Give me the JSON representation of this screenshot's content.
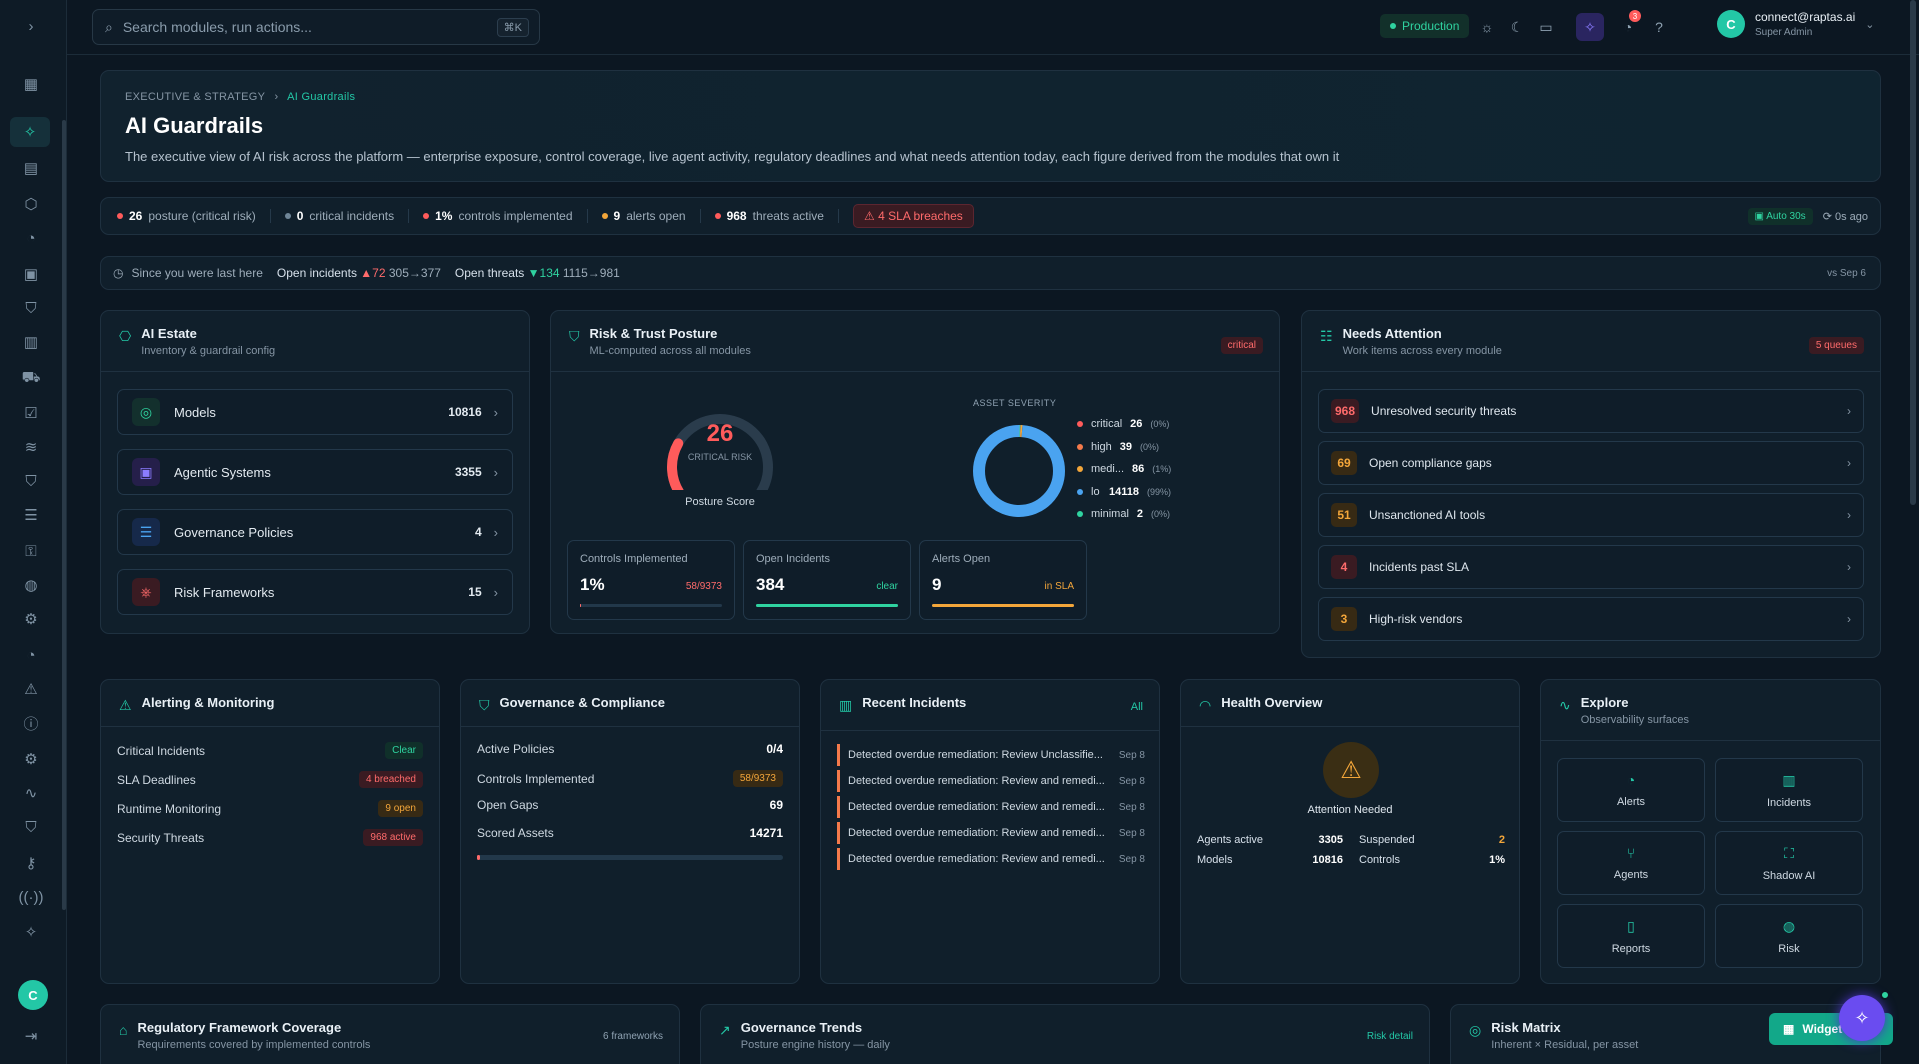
{
  "search": {
    "placeholder": "Search modules, run actions...",
    "shortcut": "⌘K"
  },
  "topbar": {
    "environment": "Production",
    "notification_count": "3",
    "user_email": "connect@raptas.ai",
    "user_role": "Super Admin",
    "avatar_letter": "C"
  },
  "rail": {
    "avatar_letter": "C"
  },
  "hero": {
    "crumb_parent": "EXECUTIVE & STRATEGY",
    "crumb_current": "AI Guardrails",
    "title": "AI Guardrails",
    "description": "The executive view of AI risk across the platform — enterprise exposure, control coverage, live agent activity, regulatory deadlines and what needs attention today, each figure derived from the modules that own it"
  },
  "stats": {
    "items": [
      {
        "value": "26",
        "label": "posture (critical risk)",
        "color": "#ff5b5b"
      },
      {
        "value": "0",
        "label": "critical incidents",
        "color": "#6f8597"
      },
      {
        "value": "1%",
        "label": "controls implemented",
        "color": "#ff5b5b"
      },
      {
        "value": "9",
        "label": "alerts open",
        "color": "#f3a63a"
      },
      {
        "value": "968",
        "label": "threats active",
        "color": "#ff5b5b"
      }
    ],
    "breaches": "4 SLA breaches",
    "auto": "Auto 30s",
    "ago": "0s ago"
  },
  "since": {
    "label": "Since you were last here",
    "incidents_label": "Open incidents",
    "incidents_delta": "▲72",
    "incidents_range": "305→377",
    "threats_label": "Open threats",
    "threats_delta": "▼134",
    "threats_range": "1115→981",
    "vs": "vs Sep 6"
  },
  "estate": {
    "title": "AI Estate",
    "subtitle": "Inventory & guardrail config",
    "items": [
      {
        "label": "Models",
        "value": "10816"
      },
      {
        "label": "Agentic Systems",
        "value": "3355"
      },
      {
        "label": "Governance Policies",
        "value": "4"
      },
      {
        "label": "Risk Frameworks",
        "value": "15"
      }
    ]
  },
  "posture": {
    "title": "Risk & Trust Posture",
    "subtitle": "ML-computed across all modules",
    "badge": "critical",
    "score": "26",
    "score_fraction": 0.26,
    "score_label": "CRITICAL RISK",
    "caption": "Posture Score",
    "severity_title": "ASSET SEVERITY",
    "severity": [
      {
        "label": "critical",
        "value": "26",
        "pct": "(0%)",
        "color": "#ff5b5b"
      },
      {
        "label": "high",
        "value": "39",
        "pct": "(0%)",
        "color": "#f47a4b"
      },
      {
        "label": "medi...",
        "value": "86",
        "pct": "(1%)",
        "color": "#f3a63a"
      },
      {
        "label": "lo",
        "value": "14118",
        "pct": "(99%)",
        "color": "#4aa3f0"
      },
      {
        "label": "minimal",
        "value": "2",
        "pct": "(0%)",
        "color": "#2fd3a0"
      }
    ],
    "minis": [
      {
        "label": "Controls Implemented",
        "value": "1%",
        "side": "58/9373",
        "side_color": "#ff6b6b",
        "fill": 0.01,
        "bar_color": "#ff6b6b"
      },
      {
        "label": "Open Incidents",
        "value": "384",
        "side": "clear",
        "side_color": "#2fd3a0",
        "fill": 1,
        "bar_color": "#2fd3a0"
      },
      {
        "label": "Alerts Open",
        "value": "9",
        "side": "in SLA",
        "side_color": "#f3a63a",
        "fill": 1,
        "bar_color": "#f3a63a"
      }
    ]
  },
  "attention": {
    "title": "Needs Attention",
    "subtitle": "Work items across every module",
    "badge": "5 queues",
    "items": [
      {
        "num": "968",
        "label": "Unresolved security threats",
        "color": "#ff6b6b",
        "bg": "#3a1b22"
      },
      {
        "num": "69",
        "label": "Open compliance gaps",
        "color": "#f3a63a",
        "bg": "#372a14"
      },
      {
        "num": "51",
        "label": "Unsanctioned AI tools",
        "color": "#f3a63a",
        "bg": "#372a14"
      },
      {
        "num": "4",
        "label": "Incidents past SLA",
        "color": "#ff6b6b",
        "bg": "#3a1b22"
      },
      {
        "num": "3",
        "label": "High-risk vendors",
        "color": "#f3a63a",
        "bg": "#372a14"
      }
    ]
  },
  "alerting": {
    "title": "Alerting & Monitoring",
    "items": [
      {
        "label": "Critical Incidents",
        "badge": "Clear",
        "kind": "b-grn"
      },
      {
        "label": "SLA Deadlines",
        "badge": "4 breached",
        "kind": "b-red"
      },
      {
        "label": "Runtime Monitoring",
        "badge": "9 open",
        "kind": "b-org"
      },
      {
        "label": "Security Threats",
        "badge": "968 active",
        "kind": "b-red"
      }
    ]
  },
  "governance": {
    "title": "Governance & Compliance",
    "items": [
      {
        "label": "Active Policies",
        "value": "0/4"
      },
      {
        "label": "Controls Implemented",
        "value": "58/9373"
      },
      {
        "label": "Open Gaps",
        "value": "69"
      },
      {
        "label": "Scored Assets",
        "value": "14271"
      }
    ],
    "progress": 0.01
  },
  "incidents": {
    "title": "Recent Incidents",
    "link": "All",
    "items": [
      {
        "text": "Detected overdue remediation: Review Unclassifie...",
        "date": "Sep 8"
      },
      {
        "text": "Detected overdue remediation: Review and remedi...",
        "date": "Sep 8"
      },
      {
        "text": "Detected overdue remediation: Review and remedi...",
        "date": "Sep 8"
      },
      {
        "text": "Detected overdue remediation: Review and remedi...",
        "date": "Sep 8"
      },
      {
        "text": "Detected overdue remediation: Review and remedi...",
        "date": "Sep 8"
      }
    ]
  },
  "health": {
    "title": "Health Overview",
    "status": "Attention Needed",
    "agents_label": "Agents active",
    "agents": "3305",
    "suspended_label": "Suspended",
    "suspended": "2",
    "models_label": "Models",
    "models": "10816",
    "controls_label": "Controls",
    "controls": "1%"
  },
  "explore": {
    "title": "Explore",
    "subtitle": "Observability surfaces",
    "tiles": [
      {
        "label": "Alerts",
        "icon": "bell-icon"
      },
      {
        "label": "Incidents",
        "icon": "clipboard-icon"
      },
      {
        "label": "Agents",
        "icon": "branch-icon"
      },
      {
        "label": "Shadow AI",
        "icon": "scan-icon"
      },
      {
        "label": "Reports",
        "icon": "book-icon"
      },
      {
        "label": "Risk",
        "icon": "gauge-icon"
      }
    ]
  },
  "bottom": {
    "reg_title": "Regulatory Framework Coverage",
    "reg_sub": "Requirements covered by implemented controls",
    "reg_badge": "6 frameworks",
    "trend_title": "Governance Trends",
    "trend_sub": "Posture engine history — daily",
    "trend_link": "Risk detail",
    "matrix_title": "Risk Matrix",
    "matrix_sub": "Inherent × Residual, per asset",
    "widget_label": "Widget"
  }
}
